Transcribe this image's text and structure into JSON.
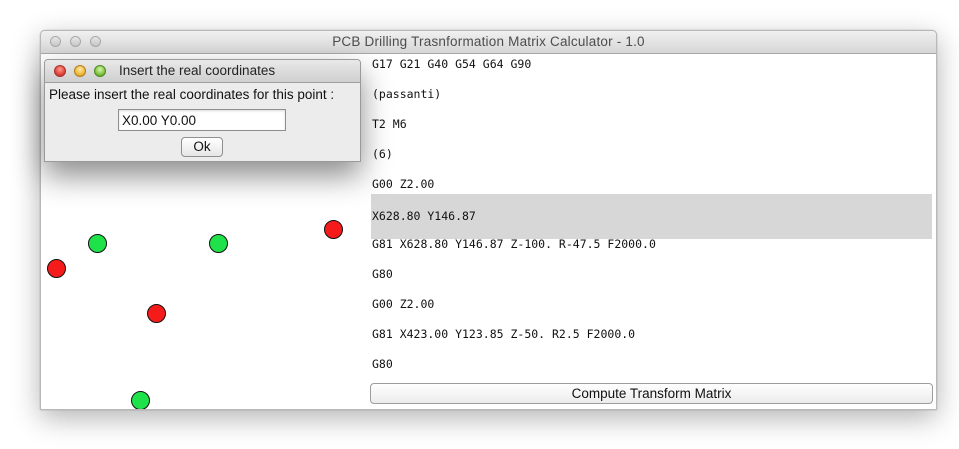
{
  "window": {
    "title": "PCB Drilling Trasnformation Matrix Calculator - 1.0"
  },
  "dialog": {
    "title": "Insert the real coordinates",
    "prompt": "Please insert the real coordinates for this point :",
    "input_value": "X0.00 Y0.00",
    "ok_label": "Ok"
  },
  "gcode": {
    "lines": [
      "G17 G21 G40 G54 G64  G90",
      "(passanti)",
      "T2 M6",
      "(6)",
      "G00 Z2.00",
      "X628.80 Y146.87",
      "G81 X628.80 Y146.87 Z-100. R-47.5 F2000.0",
      "G80",
      "G00 Z2.00",
      "G81 X423.00 Y123.85 Z-50. R2.5 F2000.0",
      "G80"
    ],
    "selected_index": 5
  },
  "compute_label": "Compute Transform Matrix",
  "colors": {
    "point_green": "#1fe14a",
    "point_red": "#f51b1b",
    "selected_line": "#d7d7d7"
  }
}
